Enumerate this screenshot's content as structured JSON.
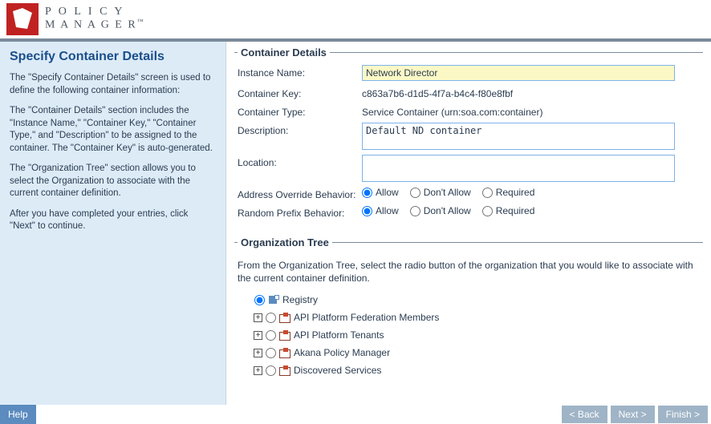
{
  "brand": {
    "line1": "P O L I C Y",
    "line2": "M A N A G E R",
    "tm": "™"
  },
  "sidebar": {
    "title": "Specify Container Details",
    "p1": "The \"Specify Container Details\" screen is used to define the following container information:",
    "p2": "The \"Container Details\" section includes the \"Instance Name,\" \"Container Key,\" \"Container Type,\" and \"Description\" to be assigned to the container. The \"Container Key\" is auto-generated.",
    "p3": "The \"Organization Tree\" section allows you to select the Organization to associate with the current container definition.",
    "p4": "After you have completed your entries, click \"Next\" to continue."
  },
  "details": {
    "legend": "Container Details",
    "labels": {
      "instance_name": "Instance Name:",
      "container_key": "Container Key:",
      "container_type": "Container Type:",
      "description": "Description:",
      "location": "Location:",
      "addr_override": "Address Override Behavior:",
      "random_prefix": "Random Prefix Behavior:"
    },
    "values": {
      "instance_name": "Network Director",
      "container_key": "c863a7b6-d1d5-4f7a-b4c4-f80e8fbf",
      "container_type": "Service Container  (urn:soa.com:container)",
      "description": "Default ND container",
      "location": ""
    },
    "radio_opts": {
      "allow": "Allow",
      "dont_allow": "Don't Allow",
      "required": "Required"
    },
    "addr_override_selected": "allow",
    "random_prefix_selected": "allow"
  },
  "org_tree": {
    "legend": "Organization Tree",
    "info": "From the Organization Tree, select the radio button of the organization that you would like to associate with the current container definition.",
    "nodes": [
      {
        "label": "Registry",
        "icon": "registry",
        "expandable": false,
        "selected": true
      },
      {
        "label": "API Platform Federation Members",
        "icon": "org",
        "expandable": true,
        "selected": false
      },
      {
        "label": "API Platform Tenants",
        "icon": "org",
        "expandable": true,
        "selected": false
      },
      {
        "label": "Akana Policy Manager",
        "icon": "org",
        "expandable": true,
        "selected": false
      },
      {
        "label": "Discovered Services",
        "icon": "org",
        "expandable": true,
        "selected": false
      }
    ]
  },
  "footer": {
    "help": "Help",
    "back": "< Back",
    "next": "Next >",
    "finish": "Finish >"
  }
}
